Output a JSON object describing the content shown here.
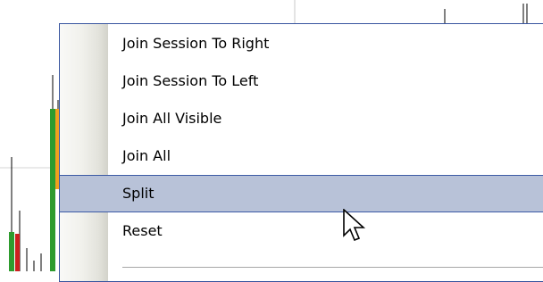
{
  "context_menu": {
    "items": [
      {
        "label": "Join Session To Right",
        "state": "normal"
      },
      {
        "label": "Join Session To Left",
        "state": "normal"
      },
      {
        "label": "Join All Visible",
        "state": "normal"
      },
      {
        "label": "Join All",
        "state": "normal"
      },
      {
        "label": "Split",
        "state": "hover"
      },
      {
        "label": "Reset",
        "state": "normal"
      }
    ]
  },
  "colors": {
    "menu_border": "#38559f",
    "highlight_fill": "#b8c2d8",
    "highlight_border": "#3c5aa5",
    "candle_green": "#2e9b2e",
    "candle_red": "#cc1f1f",
    "candle_orange": "#f0a020"
  },
  "icons": {
    "cursor": "arrow-cursor-icon"
  }
}
